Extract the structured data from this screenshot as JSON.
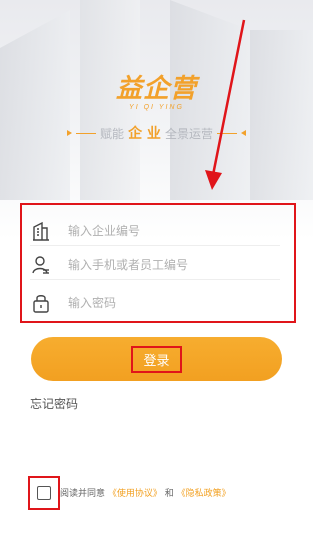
{
  "brand": {
    "logo_text": "益企营",
    "logo_subtitle": "YI QI YING",
    "tagline_prefix": "赋能",
    "tagline_highlight": "企 业",
    "tagline_suffix": "全景运营"
  },
  "form": {
    "company_code_placeholder": "输入企业编号",
    "phone_placeholder": "输入手机或者员工编号",
    "password_placeholder": "输入密码"
  },
  "actions": {
    "login_label": "登录",
    "forgot_label": "忘记密码"
  },
  "agreement": {
    "prefix": "阅读并同意",
    "terms_link": "《使用协议》",
    "connector": "和",
    "privacy_link": "《隐私政策》"
  },
  "colors": {
    "accent": "#f2a021",
    "annotation_red": "#e0151a"
  },
  "icons": {
    "company": "building-icon",
    "user": "user-icon",
    "password": "lock-icon"
  }
}
